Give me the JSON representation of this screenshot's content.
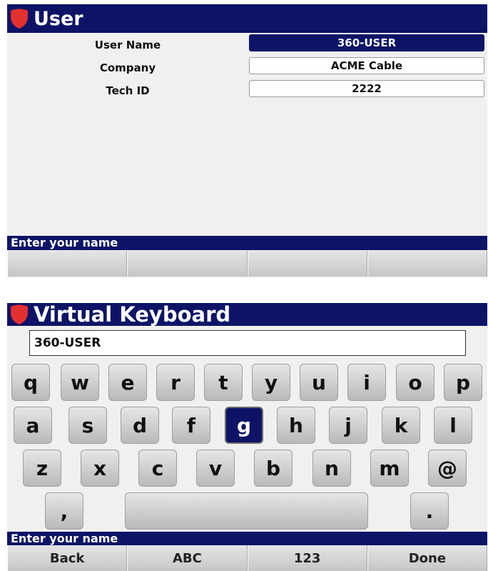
{
  "colors": {
    "title_bar": "#0d1466",
    "shield": "#e53030",
    "selected": "#0d1466"
  },
  "user_screen": {
    "title": "User",
    "fields": [
      {
        "label": "User Name",
        "value": "360-USER",
        "selected": true
      },
      {
        "label": "Company",
        "value": "ACME Cable",
        "selected": false
      },
      {
        "label": "Tech ID",
        "value": "2222",
        "selected": false
      }
    ],
    "hint": "Enter your name",
    "softkeys": [
      "",
      "",
      "",
      ""
    ]
  },
  "keyboard_screen": {
    "title": "Virtual Keyboard",
    "entry_value": "360-USER",
    "rows": [
      [
        "q",
        "w",
        "e",
        "r",
        "t",
        "y",
        "u",
        "i",
        "o",
        "p"
      ],
      [
        "a",
        "s",
        "d",
        "f",
        "g",
        "h",
        "j",
        "k",
        "l"
      ],
      [
        "z",
        "x",
        "c",
        "v",
        "b",
        "n",
        "m",
        "@"
      ],
      [
        ",",
        "",
        ".",
        ""
      ]
    ],
    "selected_key": "g",
    "hint": "Enter your name",
    "softkeys": [
      "Back",
      "ABC",
      "123",
      "Done"
    ]
  }
}
